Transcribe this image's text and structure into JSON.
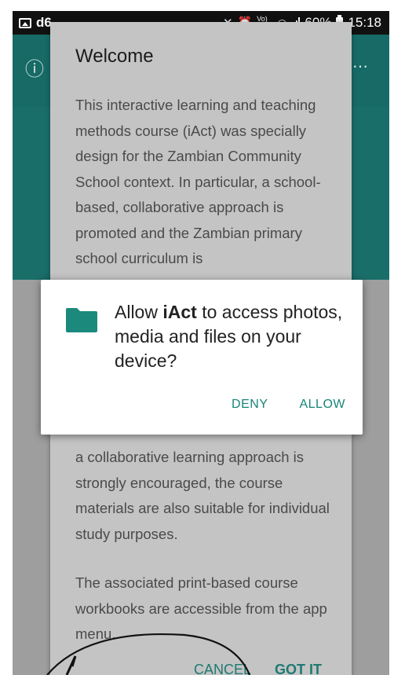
{
  "status_bar": {
    "carrier": "d6",
    "volte": "Vo) LTE",
    "battery": "60%",
    "time": "15:18"
  },
  "dialog": {
    "title": "Welcome",
    "paragraph1": "This interactive learning and teaching methods course (iAct) was specially design for the Zambian Community School context. In particular, a school-based, collaborative approach is promoted and the Zambian primary school curriculum is",
    "paragraph2": "a collaborative learning approach is strongly encouraged, the course materials are also suitable for individual study purposes.",
    "paragraph3": "The associated print-based course workbooks are accessible from the app menu.",
    "cancel_label": "CANCEL",
    "gotit_label": "GOT IT"
  },
  "permission": {
    "prefix": "Allow ",
    "app_name": "iAct",
    "suffix": " to access photos, media and files on your device?",
    "deny_label": "DENY",
    "allow_label": "ALLOW"
  },
  "colors": {
    "accent": "#17857a",
    "app_bar": "#176a66"
  }
}
